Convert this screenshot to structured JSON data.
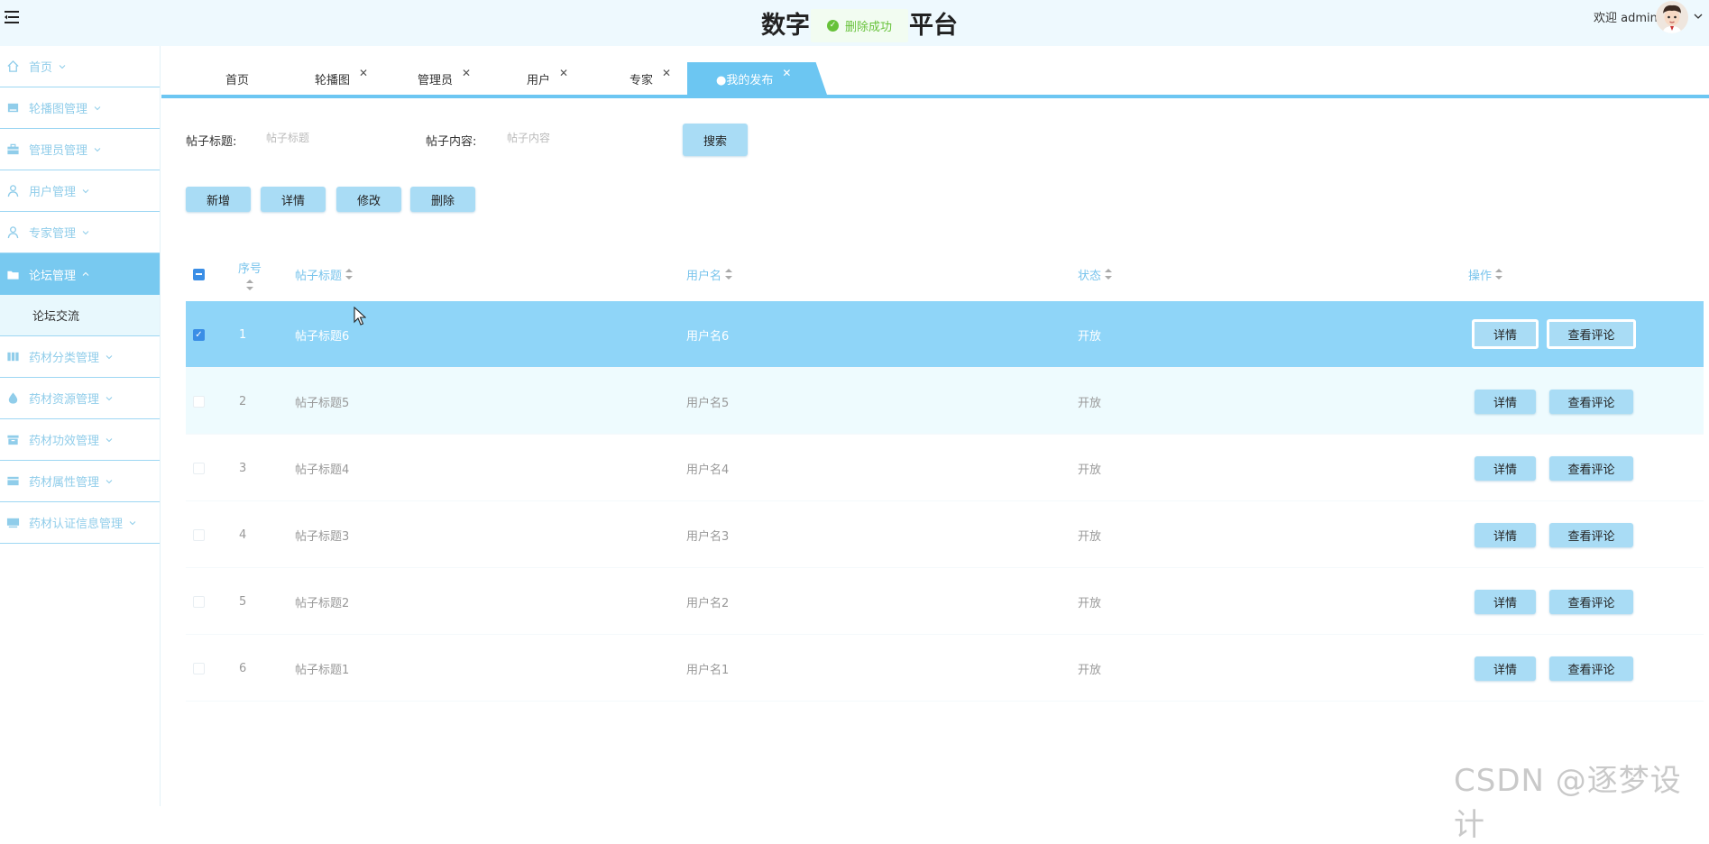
{
  "header": {
    "title_left": "数字",
    "title_right": "平台",
    "toast": "删除成功",
    "welcome": "欢迎 admin"
  },
  "sidebar": {
    "items": [
      {
        "label": "首页",
        "icon": "home-icon"
      },
      {
        "label": "轮播图管理",
        "icon": "image-icon"
      },
      {
        "label": "管理员管理",
        "icon": "briefcase-icon"
      },
      {
        "label": "用户管理",
        "icon": "user-icon"
      },
      {
        "label": "专家管理",
        "icon": "user-icon"
      },
      {
        "label": "论坛管理",
        "icon": "folder-icon",
        "active": true
      },
      {
        "label": "药材分类管理",
        "icon": "columns-icon"
      },
      {
        "label": "药材资源管理",
        "icon": "drop-icon"
      },
      {
        "label": "药材功效管理",
        "icon": "box-icon"
      },
      {
        "label": "药材属性管理",
        "icon": "card-icon"
      },
      {
        "label": "药材认证信息管理",
        "icon": "monitor-icon"
      }
    ],
    "sub_item": "论坛交流"
  },
  "tabs": [
    {
      "label": "首页",
      "closable": false
    },
    {
      "label": "轮播图",
      "closable": true
    },
    {
      "label": "管理员",
      "closable": true
    },
    {
      "label": "用户",
      "closable": true
    },
    {
      "label": "专家",
      "closable": true
    },
    {
      "label": "●我的发布",
      "closable": true,
      "active": true
    }
  ],
  "search": {
    "title_label": "帖子标题:",
    "title_placeholder": "帖子标题",
    "content_label": "帖子内容:",
    "content_placeholder": "帖子内容",
    "button": "搜索"
  },
  "actions": {
    "add": "新增",
    "detail": "详情",
    "edit": "修改",
    "delete": "删除"
  },
  "table": {
    "columns": {
      "index": "序号",
      "title": "帖子标题",
      "username": "用户名",
      "status": "状态",
      "ops": "操作"
    },
    "row_buttons": {
      "detail": "详情",
      "comments": "查看评论"
    },
    "rows": [
      {
        "index": "1",
        "title": "帖子标题6",
        "username": "用户名6",
        "status": "开放"
      },
      {
        "index": "2",
        "title": "帖子标题5",
        "username": "用户名5",
        "status": "开放"
      },
      {
        "index": "3",
        "title": "帖子标题4",
        "username": "用户名4",
        "status": "开放"
      },
      {
        "index": "4",
        "title": "帖子标题3",
        "username": "用户名3",
        "status": "开放"
      },
      {
        "index": "5",
        "title": "帖子标题2",
        "username": "用户名2",
        "status": "开放"
      },
      {
        "index": "6",
        "title": "帖子标题1",
        "username": "用户名1",
        "status": "开放"
      }
    ]
  },
  "watermark": "CSDN @逐梦设计",
  "colors": {
    "primary": "#6cc6f2",
    "button": "#a9dcf5",
    "selected_row": "#8fd5f8",
    "success": "#67c23a"
  }
}
